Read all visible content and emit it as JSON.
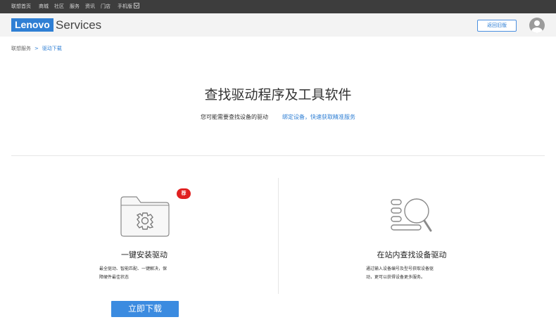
{
  "topbar": {
    "links": [
      "联想首页",
      "商城",
      "社区",
      "服务",
      "资讯",
      "门店",
      "手机版"
    ]
  },
  "header": {
    "logo_text": "Lenovo",
    "brand_text": "Services",
    "return_label": "返回旧版"
  },
  "breadcrumb": {
    "home": "联想服务",
    "separator": ">",
    "current": "驱动下载"
  },
  "main": {
    "title": "查找驱动程序及工具软件",
    "subtitle": "您可能需要查找设备的驱动",
    "bind_link": "绑定设备，快速获取精准服务"
  },
  "left_panel": {
    "badge": "荐",
    "title": "一键安装驱动",
    "desc_line1": "最全驱动、智能匹配、一键解决，保",
    "desc_line2": "障硬件最佳状态",
    "button": "立即下载"
  },
  "right_panel": {
    "title": "在站内查找设备驱动",
    "desc_line1": "通过输入设备编号及型号获取设备驱",
    "desc_line2": "动，更可以获得设备更多服务。"
  },
  "colors": {
    "accent": "#2f7fd4",
    "badge_red": "#e02020",
    "topbar_bg": "#3d3d3d"
  }
}
